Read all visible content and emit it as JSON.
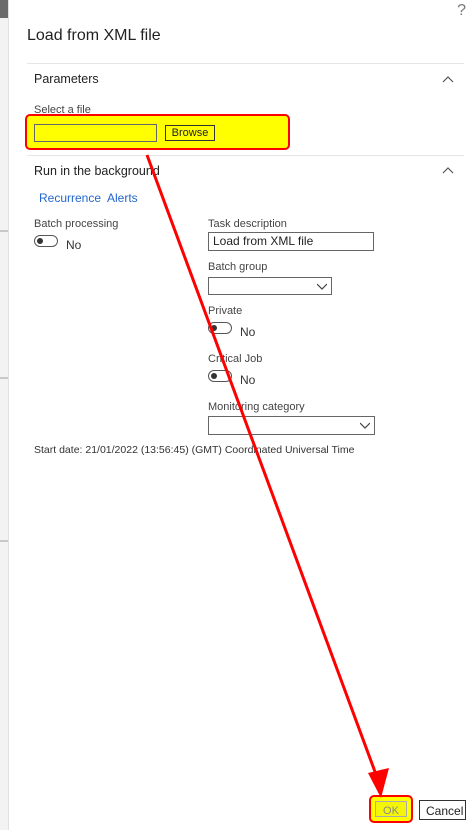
{
  "dialog": {
    "title": "Load from XML file",
    "help_glyph": "?"
  },
  "parameters": {
    "header": "Parameters",
    "select_file_label": "Select a file",
    "browse_label": "Browse",
    "file_value": ""
  },
  "background": {
    "header": "Run in the background",
    "tabs": [
      {
        "label": "Recurrence"
      },
      {
        "label": "Alerts"
      }
    ],
    "batch_processing": {
      "label": "Batch processing",
      "value": "No"
    },
    "task_description": {
      "label": "Task description",
      "value": "Load from XML file"
    },
    "batch_group": {
      "label": "Batch group",
      "value": ""
    },
    "private": {
      "label": "Private",
      "value": "No"
    },
    "critical_job": {
      "label": "Critical Job",
      "value": "No"
    },
    "monitoring_category": {
      "label": "Monitoring category",
      "value": ""
    },
    "start_date": "Start date: 21/01/2022 (13:56:45) (GMT) Coordinated Universal Time"
  },
  "footer": {
    "ok_label": "OK",
    "cancel_label": "Cancel"
  },
  "annotation": {
    "highlight_color": "#ffff00",
    "arrow_color": "#ff0000"
  }
}
